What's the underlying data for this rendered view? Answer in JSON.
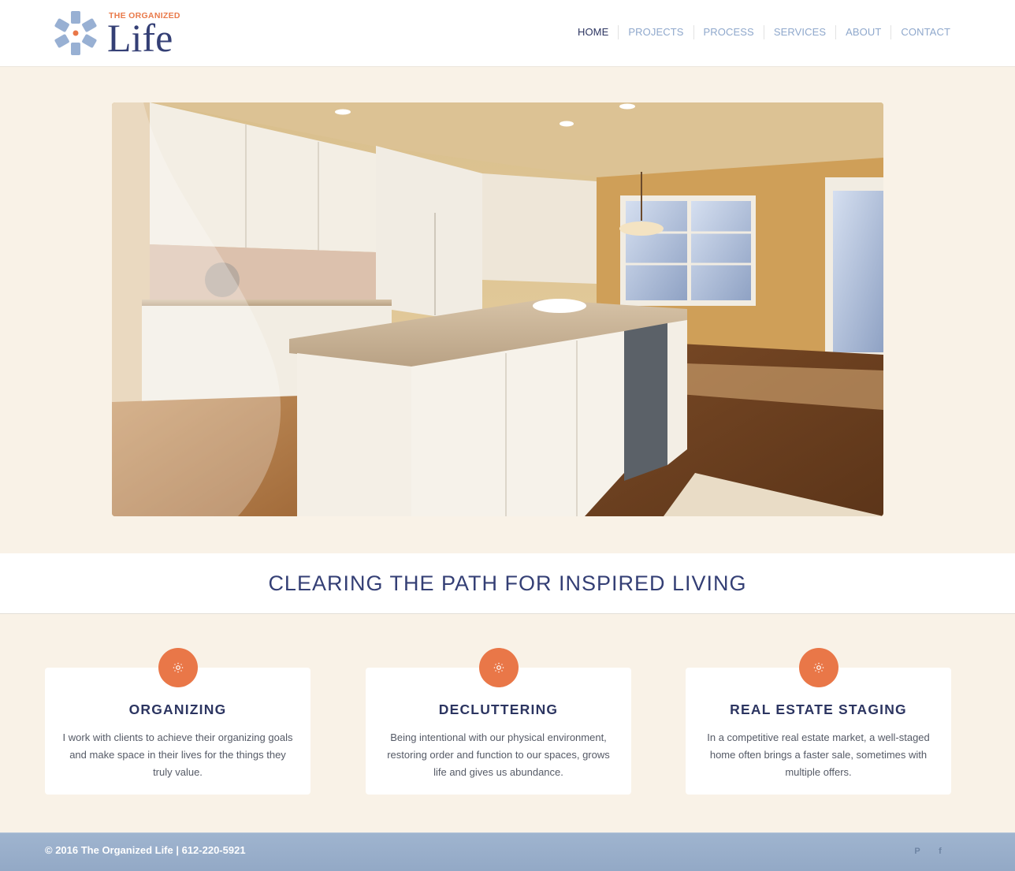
{
  "brand": {
    "small_text": "THE ORGANIZED",
    "big_text": "Life",
    "colors": {
      "orange": "#e97748",
      "navy": "#343f75",
      "blue": "#8fa8cc"
    }
  },
  "nav": {
    "items": [
      {
        "label": "HOME",
        "active": true
      },
      {
        "label": "PROJECTS",
        "active": false
      },
      {
        "label": "PROCESS",
        "active": false
      },
      {
        "label": "SERVICES",
        "active": false
      },
      {
        "label": "ABOUT",
        "active": false
      },
      {
        "label": "CONTACT",
        "active": false
      }
    ]
  },
  "hero": {
    "image_alt": "Bright kitchen with white cabinets, granite island, and hardwood floors"
  },
  "tagline": "CLEARING THE PATH FOR INSPIRED LIVING",
  "services": [
    {
      "icon": "sun-icon",
      "title": "ORGANIZING",
      "text": "I work with clients to achieve their organizing goals and make space in their lives for the things they truly value."
    },
    {
      "icon": "sun-icon",
      "title": "DECLUTTERING",
      "text": "Being intentional with our physical environment, restoring order and function to our spaces, grows life and gives us abundance."
    },
    {
      "icon": "sun-icon",
      "title": "REAL ESTATE STAGING",
      "text": "In a competitive real estate market, a well-staged home often brings a faster sale, sometimes with multiple offers."
    }
  ],
  "footer": {
    "text": "© 2016 The Organized Life | 612-220-5921",
    "social": [
      {
        "icon": "pinterest-icon",
        "glyph": "P"
      },
      {
        "icon": "facebook-icon",
        "glyph": "f"
      }
    ]
  }
}
